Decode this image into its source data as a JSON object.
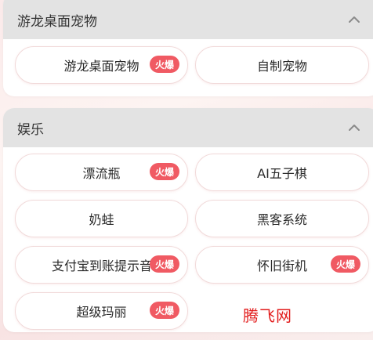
{
  "sections": [
    {
      "title": "游龙桌面宠物",
      "items": [
        {
          "label": "游龙桌面宠物",
          "badge": "火爆"
        },
        {
          "label": "自制宠物",
          "badge": ""
        }
      ]
    },
    {
      "title": "娱乐",
      "items": [
        {
          "label": "漂流瓶",
          "badge": "火爆"
        },
        {
          "label": "AI五子棋",
          "badge": ""
        },
        {
          "label": "奶蛙",
          "badge": ""
        },
        {
          "label": "黑客系统",
          "badge": ""
        },
        {
          "label": "支付宝到账提示音",
          "badge": "火爆"
        },
        {
          "label": "怀旧街机",
          "badge": "火爆"
        },
        {
          "label": "超级玛丽",
          "badge": "火爆"
        }
      ]
    }
  ],
  "icons": {
    "collapse": "chevron-up-icon"
  },
  "watermark": "腾飞网",
  "colors": {
    "badge": "#f05a63",
    "header": "#e3e3e3",
    "watermark": "#e21b1b"
  }
}
